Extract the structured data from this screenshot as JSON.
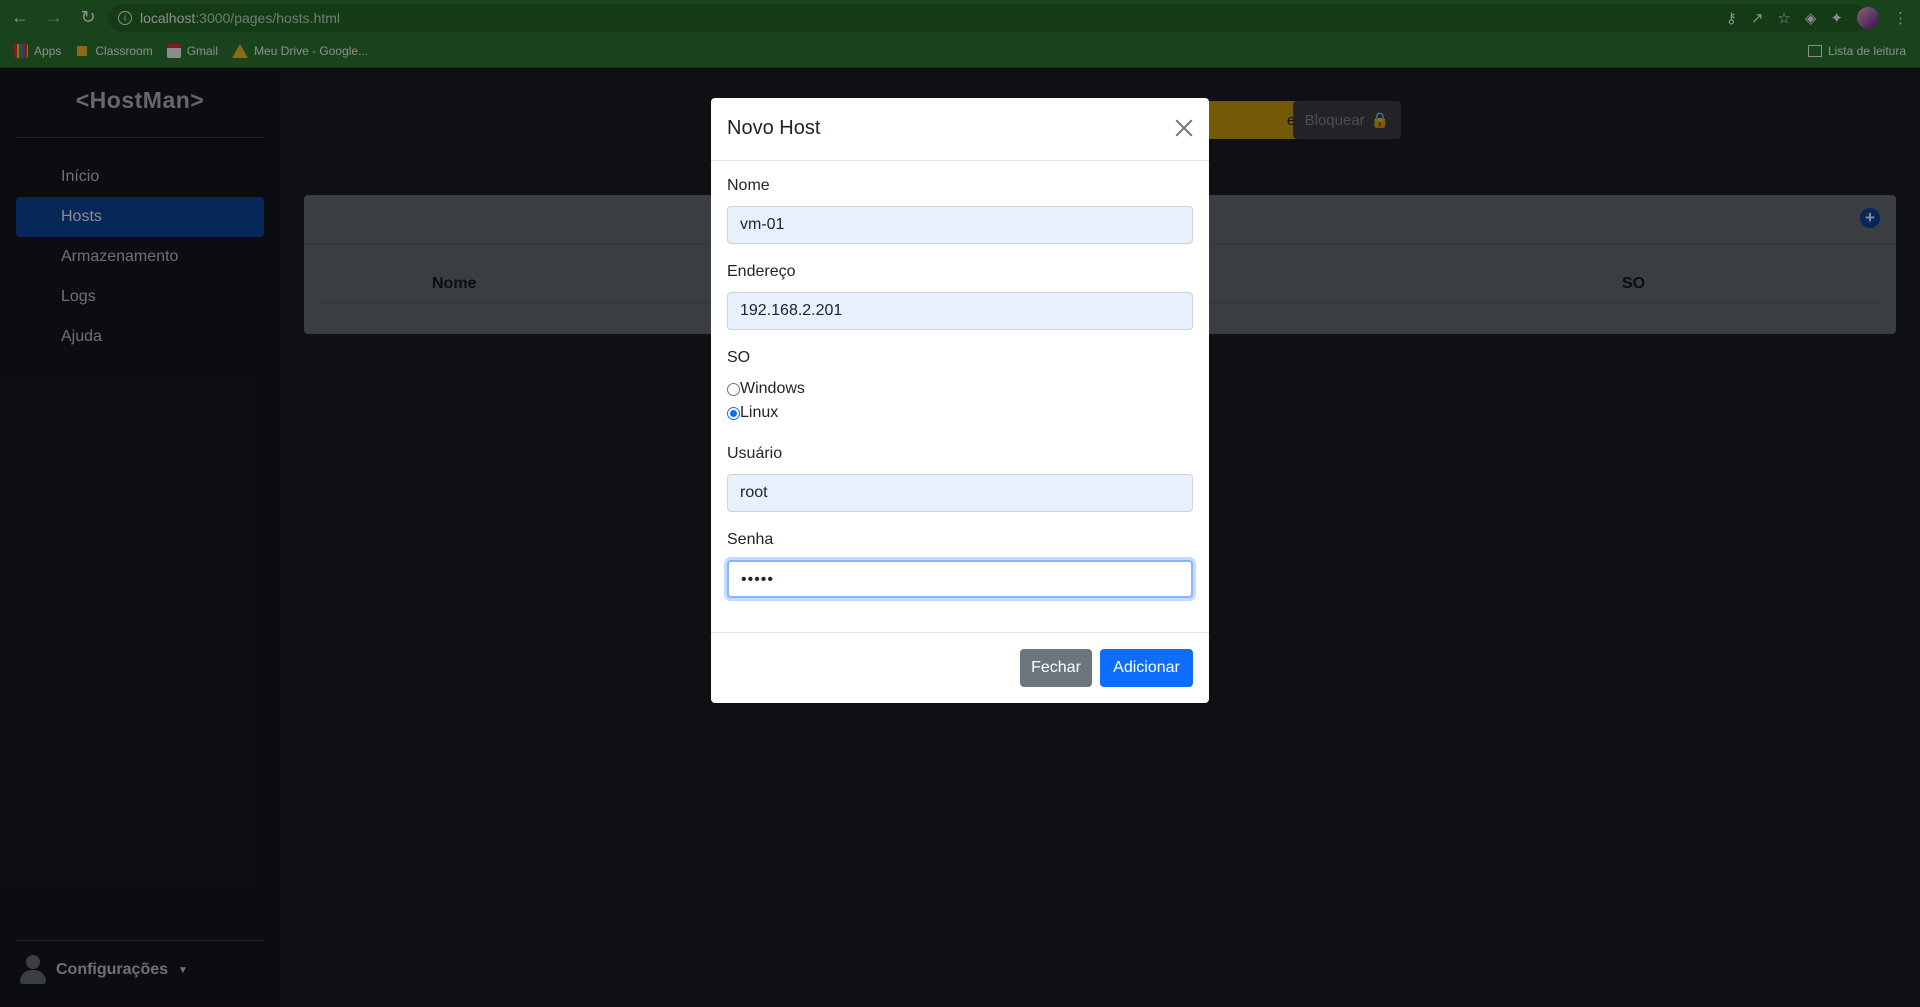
{
  "browser": {
    "url_host": "localhost",
    "url_path": ":3000/pages/hosts.html",
    "bookmarks": [
      "Apps",
      "Classroom",
      "Gmail",
      "Meu Drive - Google..."
    ],
    "reading_list": "Lista de leitura"
  },
  "sidebar": {
    "brand": "<HostMan>",
    "items": [
      {
        "label": "Início",
        "active": false
      },
      {
        "label": "Hosts",
        "active": true
      },
      {
        "label": "Armazenamento",
        "active": false
      },
      {
        "label": "Logs",
        "active": false
      },
      {
        "label": "Ajuda",
        "active": false
      }
    ],
    "settings_label": "Configurações"
  },
  "main": {
    "hibernate_label": "ernar",
    "lock_label": "Bloquear",
    "table": {
      "headers": [
        "Nome",
        "SO"
      ]
    }
  },
  "modal": {
    "title": "Novo Host",
    "fields": {
      "name_label": "Nome",
      "name_value": "vm-01",
      "address_label": "Endereço",
      "address_value": "192.168.2.201",
      "os_label": "SO",
      "os_options": [
        "Windows",
        "Linux"
      ],
      "os_selected": "Linux",
      "user_label": "Usuário",
      "user_value": "root",
      "password_label": "Senha",
      "password_value": "•••••"
    },
    "close_label": "Fechar",
    "add_label": "Adicionar"
  },
  "colors": {
    "chrome": "#2e7d32",
    "active_nav": "#0d47a1",
    "primary": "#0d6efd",
    "warning": "#d4a20c"
  }
}
